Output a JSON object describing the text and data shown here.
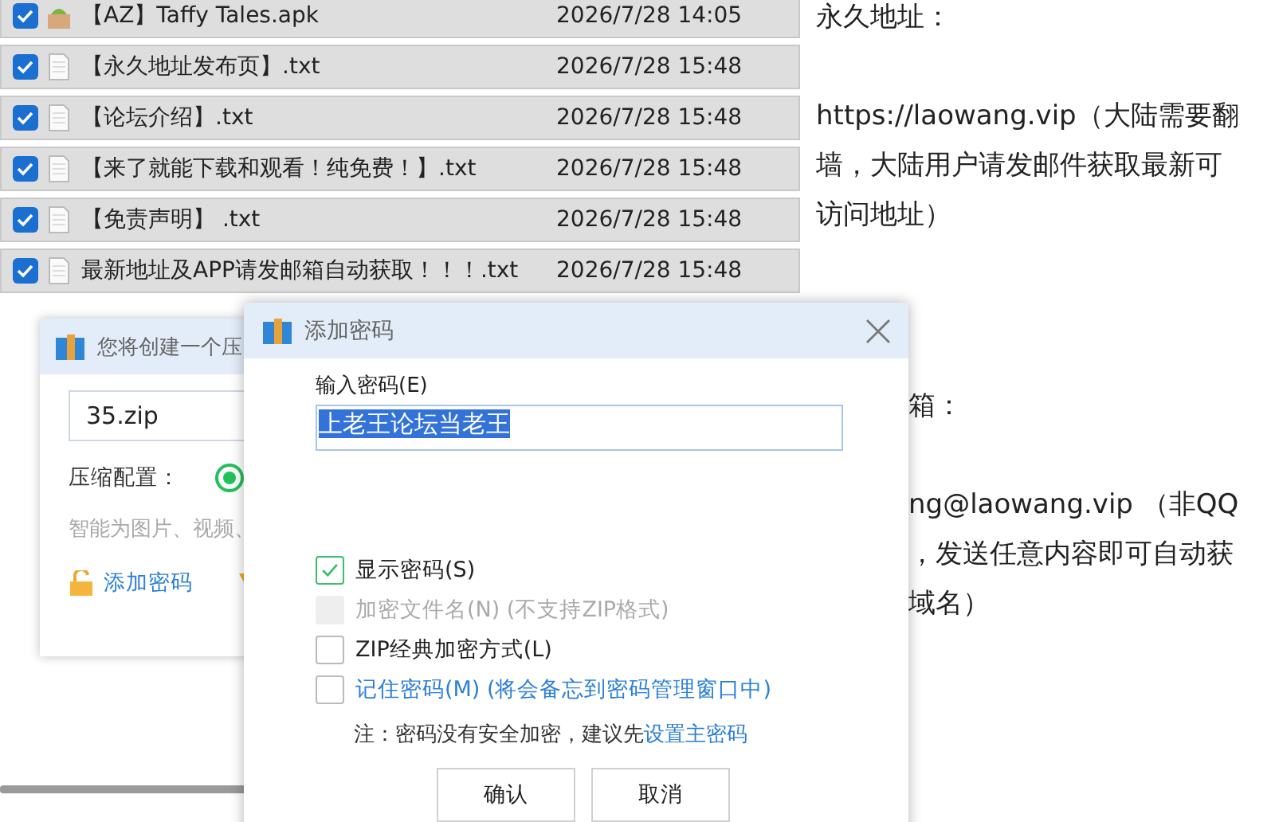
{
  "files": [
    {
      "name": "【AZ】Taffy Tales.apk",
      "date": "2026/7/28 14:05",
      "kind": "package",
      "checked": true
    },
    {
      "name": "【永久地址发布页】.txt",
      "date": "2026/7/28 15:48",
      "kind": "document",
      "checked": true
    },
    {
      "name": "【论坛介绍】.txt",
      "date": "2026/7/28 15:48",
      "kind": "document",
      "checked": true
    },
    {
      "name": "【来了就能下载和观看！纯免费！】.txt",
      "date": "2026/7/28 15:48",
      "kind": "document",
      "checked": true
    },
    {
      "name": "【免责声明】 .txt",
      "date": "2026/7/28 15:48",
      "kind": "document",
      "checked": true
    },
    {
      "name": "最新地址及APP请发邮箱自动获取！！！.txt",
      "date": "2026/7/28 15:48",
      "kind": "document",
      "checked": true
    }
  ],
  "document": {
    "upper": {
      "heading": "永久地址：",
      "lines": [
        "https://laowang.vip（大陆需要翻",
        "墙，大陆用户请发邮件获取最新可",
        "访问地址）"
      ]
    },
    "lower": {
      "heading": "箱：",
      "lines": [
        "ng@laowang.vip （非QQ",
        "，发送任意内容即可自动获",
        "域名）"
      ]
    }
  },
  "archive_dialog": {
    "title": "您将创建一个压",
    "filename": "35.zip",
    "config_label": "压缩配置：",
    "config_option_selected": true,
    "hint": "智能为图片、视频、",
    "password_link": "添加密码"
  },
  "password_dialog": {
    "title": "添加密码",
    "field_label": "输入密码(E)",
    "password": "上老王论坛当老王",
    "options": [
      {
        "label": "显示密码(S)",
        "checked": true,
        "disabled": false,
        "kind": "plain"
      },
      {
        "label": "加密文件名(N) (不支持ZIP格式)",
        "checked": false,
        "disabled": true,
        "kind": "plain"
      },
      {
        "label": "ZIP经典加密方式(L)",
        "checked": false,
        "disabled": false,
        "kind": "plain"
      },
      {
        "label": "记住密码(M) (将会备忘到密码管理窗口中)",
        "checked": false,
        "disabled": false,
        "kind": "link"
      }
    ],
    "note": "注：密码没有安全加密，建议先",
    "note_link": "设置主密码",
    "buttons": [
      "确认",
      "取消"
    ]
  }
}
